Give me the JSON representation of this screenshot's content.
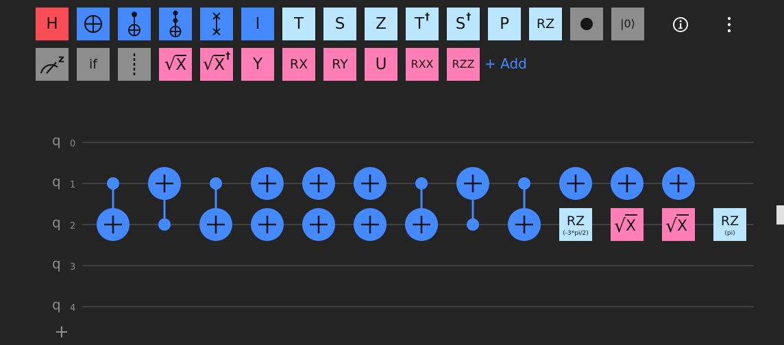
{
  "toolbar": {
    "row1": [
      {
        "name": "h-gate",
        "label": "H",
        "color": "red"
      },
      {
        "name": "cnot-gate",
        "label": "",
        "icon": "cnot-target-icon",
        "color": "blue"
      },
      {
        "name": "controlled-not-gate",
        "label": "",
        "icon": "control-target-icon",
        "color": "blue"
      },
      {
        "name": "toffoli-gate",
        "label": "",
        "icon": "toffoli-icon",
        "color": "blue"
      },
      {
        "name": "swap-gate",
        "label": "",
        "icon": "swap-icon",
        "color": "blue"
      },
      {
        "name": "i-gate",
        "label": "I",
        "color": "blue"
      },
      {
        "name": "t-gate",
        "label": "T",
        "color": "light"
      },
      {
        "name": "s-gate",
        "label": "S",
        "color": "light"
      },
      {
        "name": "z-gate",
        "label": "Z",
        "color": "light"
      },
      {
        "name": "tdg-gate",
        "label": "T",
        "dagger": "†",
        "color": "light"
      },
      {
        "name": "sdg-gate",
        "label": "S",
        "dagger": "†",
        "color": "light"
      },
      {
        "name": "p-gate",
        "label": "P",
        "color": "light"
      },
      {
        "name": "rz-gate",
        "label": "RZ",
        "color": "light"
      },
      {
        "name": "reset-dot-gate",
        "label": "",
        "icon": "filled-circle-icon",
        "color": "gray"
      },
      {
        "name": "reset-gate",
        "label": "|0⟩",
        "color": "gray"
      }
    ],
    "row2": [
      {
        "name": "measure-gate",
        "label": "",
        "icon": "measure-z-icon",
        "color": "gray"
      },
      {
        "name": "if-gate",
        "label": "if",
        "color": "gray"
      },
      {
        "name": "barrier-gate",
        "label": "",
        "icon": "barrier-icon",
        "color": "gray"
      },
      {
        "name": "sqrt-x-gate",
        "label": "X",
        "sqrt": true,
        "color": "pink"
      },
      {
        "name": "sqrt-xdg-gate",
        "label": "X",
        "sqrt": true,
        "dagger": "†",
        "color": "pink"
      },
      {
        "name": "y-gate",
        "label": "Y",
        "color": "pink"
      },
      {
        "name": "rx-gate",
        "label": "RX",
        "color": "pink"
      },
      {
        "name": "ry-gate",
        "label": "RY",
        "color": "pink"
      },
      {
        "name": "u-gate",
        "label": "U",
        "color": "pink"
      },
      {
        "name": "rxx-gate",
        "label": "RXX",
        "color": "pink"
      },
      {
        "name": "rzz-gate",
        "label": "RZZ",
        "color": "pink"
      }
    ],
    "add_label": "+ Add"
  },
  "icons": {
    "info": "info-icon",
    "more": "more-vertical-icon",
    "add_qubit": "plus-icon"
  },
  "colors": {
    "red": "#fa4d56",
    "blue": "#4589ff",
    "light": "#bae6ff",
    "gray": "#8d8d8d",
    "pink": "#ff7eb6",
    "wire": "#4a4a4a",
    "qlabel": "#8d8d8d"
  },
  "circuit": {
    "qubits": [
      {
        "prefix": "q",
        "index": "0"
      },
      {
        "prefix": "q",
        "index": "1"
      },
      {
        "prefix": "q",
        "index": "2"
      },
      {
        "prefix": "q",
        "index": "3"
      },
      {
        "prefix": "q",
        "index": "4"
      }
    ],
    "add_qubit_label": "+",
    "columns": [
      {
        "type": "cx",
        "control": 1,
        "target": 2
      },
      {
        "type": "cx",
        "control": 2,
        "target": 1
      },
      {
        "type": "cx",
        "control": 1,
        "target": 2
      },
      {
        "type": "x_pair",
        "targets": [
          1,
          2
        ]
      },
      {
        "type": "x_pair",
        "targets": [
          1,
          2
        ]
      },
      {
        "type": "x_pair",
        "targets": [
          1,
          2
        ]
      },
      {
        "type": "cx",
        "control": 1,
        "target": 2
      },
      {
        "type": "cx",
        "control": 2,
        "target": 1
      },
      {
        "type": "cx",
        "control": 1,
        "target": 2
      },
      {
        "type": "x_and_gate",
        "x": 1,
        "gate": {
          "qubit": 2,
          "label": "RZ",
          "param": "(-3*pi/2)",
          "color": "light"
        }
      },
      {
        "type": "x_and_gate",
        "x": 1,
        "gate": {
          "qubit": 2,
          "label": "X",
          "sqrt": true,
          "color": "pink"
        }
      },
      {
        "type": "x_and_gate",
        "x": 1,
        "gate": {
          "qubit": 2,
          "label": "X",
          "sqrt": true,
          "color": "pink"
        }
      },
      {
        "type": "single",
        "gate": {
          "qubit": 2,
          "label": "RZ",
          "param": "(pi)",
          "color": "light"
        }
      }
    ]
  }
}
